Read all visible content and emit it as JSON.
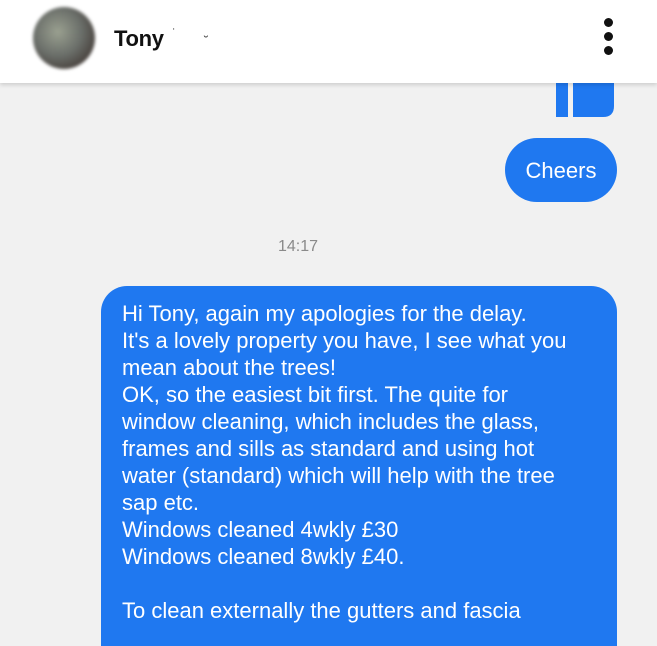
{
  "header": {
    "contact_name": "Tony",
    "more_icon": "more-vertical-icon"
  },
  "colors": {
    "outgoing_bubble": "#1f78f0",
    "background": "#f1f1f1",
    "timestamp_text": "#8a8a8a"
  },
  "messages": {
    "thumbs_up_icon": "thumbs-up-icon",
    "cheers": "Cheers",
    "timestamp": "14:17",
    "long_message_lines": [
      "Hi Tony, again my apologies for the delay.",
      "It's a lovely property you have, I see what you",
      "mean about the trees!",
      "OK, so the easiest bit first. The quite for",
      "window cleaning, which includes the glass,",
      "frames and sills as standard and using hot",
      "water (standard) which will help with the tree",
      "sap etc.",
      "Windows cleaned 4wkly £30",
      "Windows cleaned 8wkly £40.",
      "",
      "To clean externally the gutters and fascia"
    ]
  }
}
